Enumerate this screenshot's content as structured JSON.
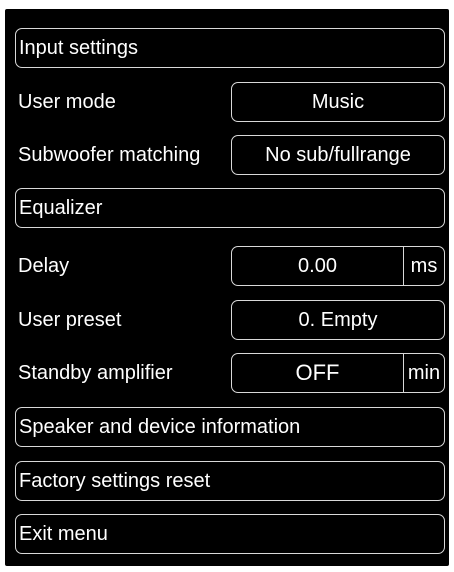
{
  "menu": {
    "input_settings": "Input settings",
    "user_mode": {
      "label": "User mode",
      "value": "Music"
    },
    "subwoofer_matching": {
      "label": "Subwoofer matching",
      "value": "No sub/fullrange"
    },
    "equalizer": "Equalizer",
    "delay": {
      "label": "Delay",
      "value": "0.00",
      "unit": "ms"
    },
    "user_preset": {
      "label": "User preset",
      "value": "0. Empty"
    },
    "standby_amplifier": {
      "label": "Standby amplifier",
      "value": "OFF",
      "unit": "min"
    },
    "speaker_device_info": "Speaker and device information",
    "factory_reset": "Factory settings reset",
    "exit_menu": "Exit menu"
  },
  "colors": {
    "background": "#000000",
    "border": "#d9d9d9",
    "text": "#ffffff"
  }
}
